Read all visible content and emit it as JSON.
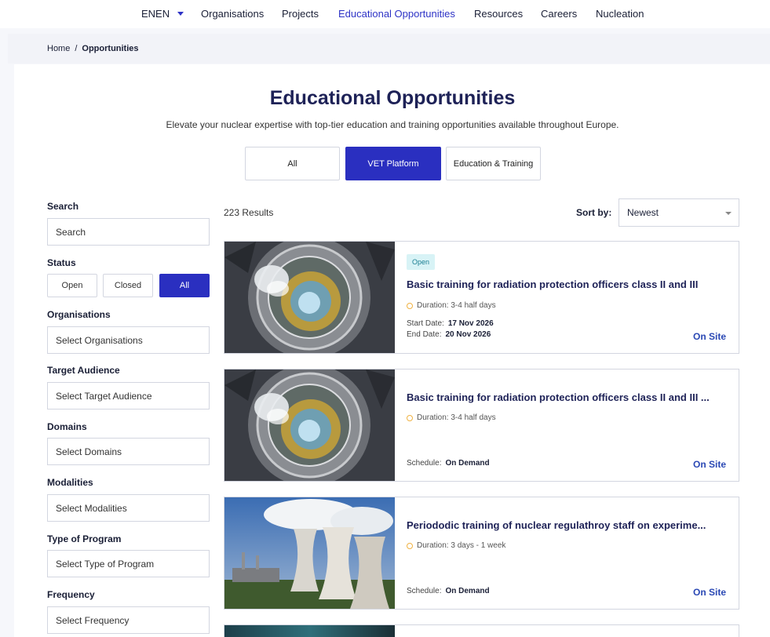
{
  "nav": {
    "lang": "ENEN",
    "items": [
      "Organisations",
      "Projects",
      "Educational Opportunities",
      "Resources",
      "Careers",
      "Nucleation"
    ]
  },
  "breadcrumb": {
    "home": "Home",
    "separator": "/",
    "current": "Opportunities"
  },
  "header": {
    "title": "Educational Opportunities",
    "subtitle": "Elevate your nuclear expertise with top-tier education and training opportunities available throughout Europe."
  },
  "tabs": [
    "All",
    "VET Platform",
    "Education & Training"
  ],
  "filters": {
    "search_label": "Search",
    "search_placeholder": "Search",
    "status_label": "Status",
    "status_options": [
      "Open",
      "Closed",
      "All"
    ],
    "organisations_label": "Organisations",
    "organisations_placeholder": "Select Organisations",
    "target_label": "Target Audience",
    "target_placeholder": "Select Target Audience",
    "domains_label": "Domains",
    "domains_placeholder": "Select Domains",
    "modalities_label": "Modalities",
    "modalities_placeholder": "Select Modalities",
    "program_label": "Type of Program",
    "program_placeholder": "Select Type of Program",
    "frequency_label": "Frequency",
    "frequency_placeholder": "Select Frequency"
  },
  "results": {
    "count": "223 Results",
    "sort_label": "Sort by:",
    "sort_value": "Newest"
  },
  "cards": [
    {
      "badge": "Open",
      "title": "Basic training for radiation protection officers class II and III",
      "duration": "Duration: 3-4 half days",
      "start_label": "Start Date:",
      "start_value": "17 Nov 2026",
      "end_label": "End Date:",
      "end_value": "20 Nov 2026",
      "mode": "On Site"
    },
    {
      "title": "Basic training for radiation protection officers class II and III ...",
      "duration": "Duration: 3-4 half days",
      "schedule_label": "Schedule:",
      "schedule_value": "On Demand",
      "mode": "On Site"
    },
    {
      "title": "Periododic training of nuclear regulathroy staff on experime...",
      "duration": "Duration: 3 days - 1 week",
      "schedule_label": "Schedule:",
      "schedule_value": "On Demand",
      "mode": "On Site"
    }
  ]
}
